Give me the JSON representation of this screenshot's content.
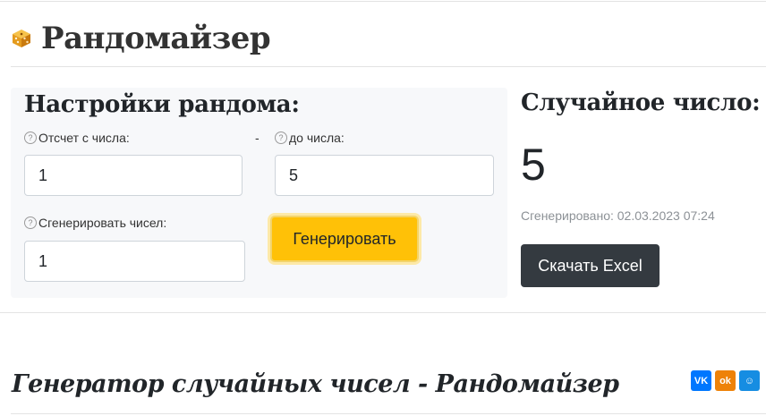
{
  "header": {
    "title": "Рандомайзер",
    "icon": "dice-icon"
  },
  "settings": {
    "title": "Настройки рандома:",
    "from_label": "Отсчет с числа:",
    "separator": "-",
    "to_label": "до числа:",
    "count_label": "Сгенерировать чисел:",
    "from_value": "1",
    "to_value": "5",
    "count_value": "1",
    "help_glyph": "?",
    "generate_button": "Генерировать"
  },
  "result": {
    "title": "Случайное число:",
    "number": "5",
    "generated_at": "Сгенерировано: 02.03.2023 07:24",
    "excel_button": "Скачать Excel"
  },
  "article": {
    "heading": "Генератор случайных чисел - Рандомайзер"
  },
  "share": {
    "vk": {
      "label": "VK",
      "color": "#0077ff"
    },
    "ok": {
      "label": "ok",
      "color": "#ee8208"
    },
    "mir": {
      "label": "☺",
      "color": "#168de2"
    }
  },
  "colors": {
    "accent": "#ffc107",
    "dark_button": "#343a40",
    "panel_bg": "#f7f8fa"
  }
}
